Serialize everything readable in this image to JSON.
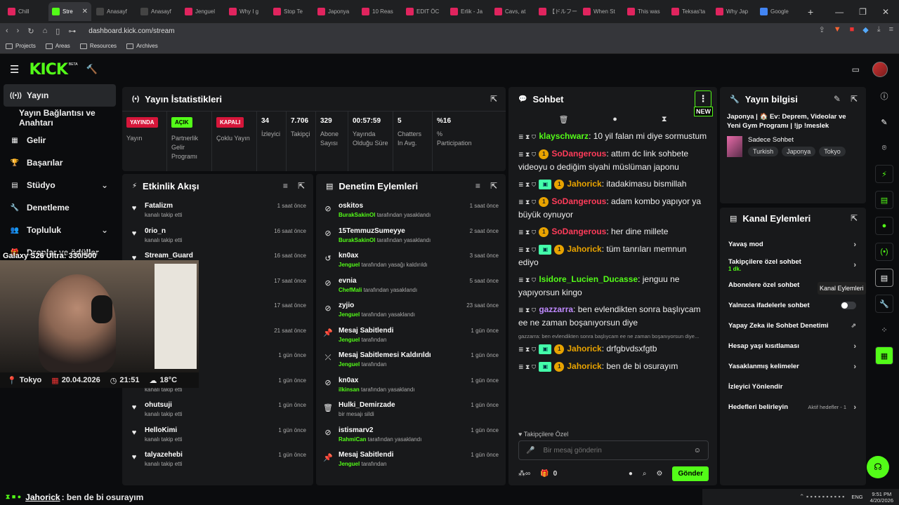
{
  "browser": {
    "tabs": [
      {
        "label": "Chill",
        "color": "#e0245e",
        "active": false
      },
      {
        "label": "Stre",
        "color": "#53fc18",
        "active": true
      },
      {
        "label": "Anasayf",
        "color": "#444",
        "active": false
      },
      {
        "label": "Anasayf",
        "color": "#444",
        "active": false
      },
      {
        "label": "Jenguel",
        "color": "#e0245e",
        "active": false
      },
      {
        "label": "Why I g",
        "color": "#e0245e",
        "active": false
      },
      {
        "label": "Stop Te",
        "color": "#e0245e",
        "active": false
      },
      {
        "label": "Japonya",
        "color": "#e0245e",
        "active": false
      },
      {
        "label": "10 Reas",
        "color": "#e0245e",
        "active": false
      },
      {
        "label": "EDIT ÖC",
        "color": "#e0245e",
        "active": false
      },
      {
        "label": "Erlik - Ja",
        "color": "#e0245e",
        "active": false
      },
      {
        "label": "Cavs, at",
        "color": "#e0245e",
        "active": false
      },
      {
        "label": "【ドルフー",
        "color": "#e0245e",
        "active": false
      },
      {
        "label": "When St",
        "color": "#e0245e",
        "active": false
      },
      {
        "label": "This was",
        "color": "#e0245e",
        "active": false
      },
      {
        "label": "Teksas'ta",
        "color": "#e0245e",
        "active": false
      },
      {
        "label": "Why Jap",
        "color": "#e0245e",
        "active": false
      },
      {
        "label": "Google",
        "color": "#4285f4",
        "active": false
      }
    ],
    "url": "dashboard.kick.com/stream",
    "bookmarks": [
      "Projects",
      "Areas",
      "Resources",
      "Archives"
    ]
  },
  "kick": {
    "logo": "KICK",
    "beta": "BETA"
  },
  "nav": [
    {
      "label": "Yayın",
      "icon": "broadcast-icon",
      "selected": true,
      "chevron": false
    },
    {
      "label": "Yayın Bağlantısı ve Anahtarı",
      "icon": "",
      "selected": false,
      "chevron": false
    },
    {
      "label": "Gelir",
      "icon": "revenue-icon",
      "selected": false,
      "chevron": false
    },
    {
      "label": "Başarılar",
      "icon": "trophy-icon",
      "selected": false,
      "chevron": false
    },
    {
      "label": "Stüdyo",
      "icon": "studio-icon",
      "selected": false,
      "chevron": true
    },
    {
      "label": "Denetleme",
      "icon": "wrench-icon",
      "selected": false,
      "chevron": false
    },
    {
      "label": "Topluluk",
      "icon": "community-icon",
      "selected": false,
      "chevron": true
    },
    {
      "label": "Droplar ve ödüller",
      "icon": "gift-icon",
      "selected": false,
      "chevron": false
    }
  ],
  "stats": {
    "title": "Yayın İstatistikleri",
    "items": [
      {
        "value": "YAYINDA",
        "label": "Yayın",
        "badge": "red"
      },
      {
        "value": "AÇIK",
        "label": "Partnerlik Gelir Programı",
        "badge": "green"
      },
      {
        "value": "KAPALI",
        "label": "Çoklu Yayın",
        "badge": "red"
      },
      {
        "value": "34",
        "label": "İzleyici"
      },
      {
        "value": "7.706",
        "label": "Takipçi"
      },
      {
        "value": "329",
        "label": "Abone Sayısı"
      },
      {
        "value": "00:57:59",
        "label": "Yayında Olduğu Süre"
      },
      {
        "value": "5",
        "label": "Chatters In Avg."
      },
      {
        "value": "%16",
        "label": "% Participation"
      }
    ]
  },
  "activity": {
    "title": "Etkinlik Akışı",
    "items": [
      {
        "name": "Fatalizm",
        "sub": "kanalı takip etti",
        "time": "1 saat önce"
      },
      {
        "name": "0rio_n",
        "sub": "kanalı takip etti",
        "time": "16 saat önce"
      },
      {
        "name": "Stream_Guard",
        "sub": "",
        "time": "16 saat önce"
      },
      {
        "name": "",
        "sub": "",
        "time": "17 saat önce"
      },
      {
        "name": "",
        "sub": "",
        "time": "17 saat önce"
      },
      {
        "name": "",
        "sub": "",
        "time": "21 saat önce"
      },
      {
        "name": "",
        "sub": "",
        "time": "1 gün önce"
      },
      {
        "name": "Acetaki",
        "sub": "kanalı takip etti",
        "time": "1 gün önce"
      },
      {
        "name": "ohutsuji",
        "sub": "kanalı takip etti",
        "time": "1 gün önce"
      },
      {
        "name": "HelloKimi",
        "sub": "kanalı takip etti",
        "time": "1 gün önce"
      },
      {
        "name": "talyazehebi",
        "sub": "kanalı takip etti",
        "time": "1 gün önce"
      }
    ]
  },
  "moderation": {
    "title": "Denetim Eylemleri",
    "items": [
      {
        "icon": "ban-icon",
        "name": "oskitos",
        "who": "BurakSakinOl",
        "sub": "tarafından yasaklandı",
        "time": "1 saat önce"
      },
      {
        "icon": "ban-icon",
        "name": "15TemmuzSumeyye",
        "who": "BurakSakinOl",
        "sub": "tarafından yasaklandı",
        "time": "2 saat önce"
      },
      {
        "icon": "undo-icon",
        "name": "kn0ax",
        "who": "Jenguel",
        "sub": "tarafından yasağı kaldırıldı",
        "time": "3 saat önce"
      },
      {
        "icon": "ban-icon",
        "name": "evnia",
        "who": "ChefMali",
        "sub": "tarafından yasaklandı",
        "time": "5 saat önce"
      },
      {
        "icon": "ban-icon",
        "name": "zyjio",
        "who": "Jenguel",
        "sub": "tarafından yasaklandı",
        "time": "23 saat önce"
      },
      {
        "icon": "pin-icon",
        "name": "Mesaj Sabitlendi",
        "who": "Jenguel",
        "sub": "tarafından",
        "time": "1 gün önce"
      },
      {
        "icon": "unpin-icon",
        "name": "Mesaj Sabitlemesi Kaldırıldı",
        "who": "Jenguel",
        "sub": "tarafından",
        "time": "1 gün önce"
      },
      {
        "icon": "ban-icon",
        "name": "kn0ax",
        "who": "ilkinsan",
        "sub": "tarafından yasaklandı",
        "time": "1 gün önce"
      },
      {
        "icon": "trash-icon",
        "name": "Hulki_Demirzade",
        "who": "",
        "sub": "bir mesajı sildi",
        "time": "1 gün önce"
      },
      {
        "icon": "ban-icon",
        "name": "istismarv2",
        "who": "RahmiCan",
        "sub": "tarafından yasaklandı",
        "time": "1 gün önce"
      },
      {
        "icon": "pin-icon",
        "name": "Mesaj Sabitlendi",
        "who": "Jenguel",
        "sub": "tarafından",
        "time": "1 gün önce"
      }
    ]
  },
  "chat": {
    "title": "Sohbet",
    "new_badge": "NEW",
    "messages": [
      {
        "user": "klayschwarz",
        "color": "#53fc18",
        "text": ": 10 yil falan mi diye sormustum",
        "coin": false,
        "sub": false
      },
      {
        "user": "SoDangerous",
        "color": "#ff3c5a",
        "text": ": attım dc link sohbete videoyu o dediğim siyahi müslüman japonu",
        "coin": true,
        "sub": false
      },
      {
        "user": "Jahorick",
        "color": "#e8a300",
        "text": ": itadakimasu bismillah",
        "coin": true,
        "sub": true
      },
      {
        "user": "SoDangerous",
        "color": "#ff3c5a",
        "text": ": adam kombo yapıyor ya büyük oynuyor",
        "coin": true,
        "sub": false
      },
      {
        "user": "SoDangerous",
        "color": "#ff3c5a",
        "text": ": her dine millete",
        "coin": true,
        "sub": false
      },
      {
        "user": "Jahorick",
        "color": "#e8a300",
        "text": ": tüm tanrıları memnun ediyo",
        "coin": true,
        "sub": true
      },
      {
        "user": "Isidore_Lucien_Ducasse",
        "color": "#53fc18",
        "text": ": jenguu ne yapıyorsun kingo",
        "coin": false,
        "sub": false
      },
      {
        "user": "gazzarra",
        "color": "#c08aff",
        "text": ": ben evlendikten sonra başlıycam ee ne zaman boşanıyorsun diye",
        "coin": false,
        "sub": false
      }
    ],
    "reply_hint": "gazzarra: ben evlendikten sonra başlıycam ee ne zaman boşanıyorsun diye...",
    "messages2": [
      {
        "user": "Jahorick",
        "color": "#e8a300",
        "text": ": drfgbvdsxfgtb",
        "coin": true,
        "sub": true
      },
      {
        "user": "Jahorick",
        "color": "#e8a300",
        "text": ": ben de bi osurayım",
        "coin": true,
        "sub": true
      }
    ],
    "follower_mode": "Takipçilere Özel",
    "input_placeholder": "Bir mesaj gönderin",
    "send_label": "Gönder",
    "count": "0"
  },
  "info": {
    "title": "Yayın bilgisi",
    "stream_title": "Japonya | 🏠 Ev: Deprem, Videolar ve Yeni Gym Programı | !jp !meslek",
    "category": "Sadece Sohbet",
    "tags": [
      "Turkish",
      "Japonya",
      "Tokyo"
    ]
  },
  "actions": {
    "title": "Kanal Eylemleri",
    "tooltip": "Kanal Eylemleri",
    "items": [
      {
        "label": "Yavaş mod",
        "sub": "",
        "type": "arrow"
      },
      {
        "label": "Takipçilere özel sohbet",
        "sub": "1 dk.",
        "type": "arrow"
      },
      {
        "label": "Abonelere özel sohbet",
        "sub": "",
        "type": "none"
      },
      {
        "label": "Yalnızca ifadelerle sohbet",
        "sub": "",
        "type": "toggle"
      },
      {
        "label": "Yapay Zeka ile Sohbet Denetimi",
        "sub": "",
        "type": "external"
      },
      {
        "label": "Hesap yaşı kısıtlaması",
        "sub": "",
        "type": "arrow"
      },
      {
        "label": "Yasaklanmış kelimeler",
        "sub": "",
        "type": "arrow"
      },
      {
        "label": "İzleyici Yönlendir",
        "sub": "",
        "type": "none"
      },
      {
        "label": "Hedefleri belirleyin",
        "sub": "Aktif hedefler - 1",
        "type": "arrow"
      }
    ]
  },
  "webcam": {
    "overlay_title": "Galaxy S26 Ultra: 330/500",
    "city": "Tokyo",
    "date": "20.04.2026",
    "time": "21:51",
    "temp": "18°C"
  },
  "ticker": {
    "user": "Jahorick",
    "text": ": ben de bi osurayım"
  },
  "taskbar": {
    "lang": "ENG",
    "clock": "9:51 PM",
    "date": "4/20/2026"
  }
}
